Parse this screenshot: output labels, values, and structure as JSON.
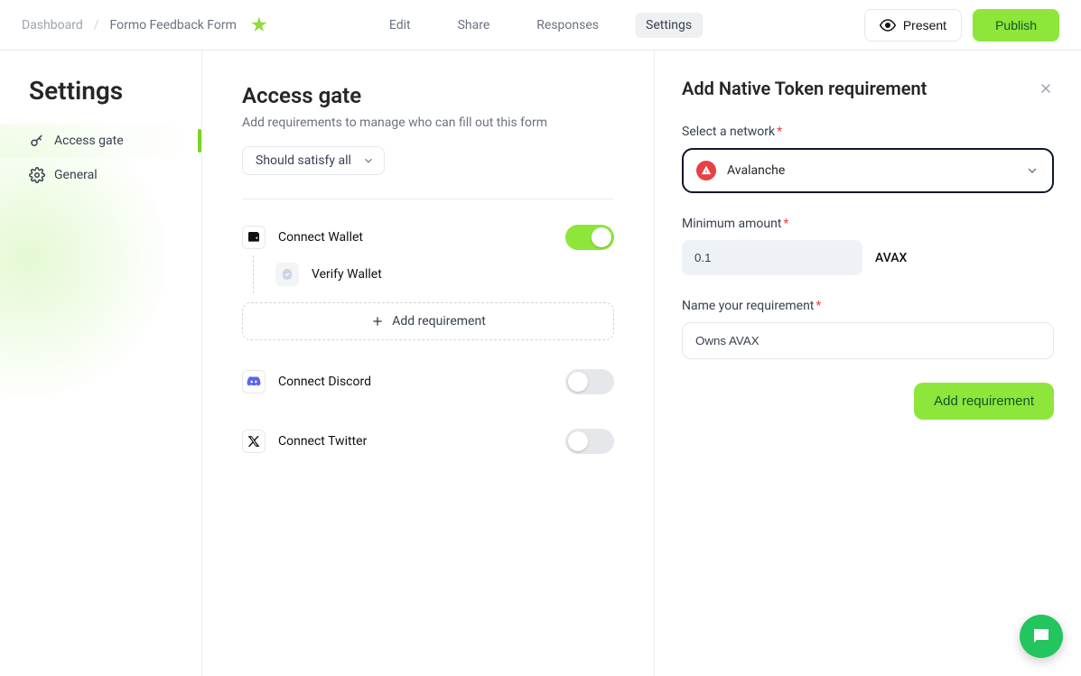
{
  "breadcrumb": {
    "dashboard": "Dashboard",
    "current": "Formo Feedback Form"
  },
  "tabs": {
    "edit": "Edit",
    "share": "Share",
    "responses": "Responses",
    "settings": "Settings"
  },
  "actions": {
    "present": "Present",
    "publish": "Publish"
  },
  "sidebar": {
    "title": "Settings",
    "items": [
      {
        "label": "Access gate"
      },
      {
        "label": "General"
      }
    ]
  },
  "main": {
    "title": "Access gate",
    "subtitle": "Add requirements to manage who can fill out this form",
    "satisfy_label": "Should satisfy all",
    "rows": {
      "wallet": "Connect Wallet",
      "verify": "Verify Wallet",
      "discord": "Connect Discord",
      "twitter": "Connect Twitter"
    },
    "add_req": "Add requirement"
  },
  "panel": {
    "title": "Add Native Token requirement",
    "network_label": "Select a network",
    "network_value": "Avalanche",
    "network_icon_letter": "A",
    "min_label": "Minimum amount",
    "min_value": "0.1",
    "ticker": "AVAX",
    "name_label": "Name your requirement",
    "name_value": "Owns AVAX",
    "add_btn": "Add requirement"
  }
}
